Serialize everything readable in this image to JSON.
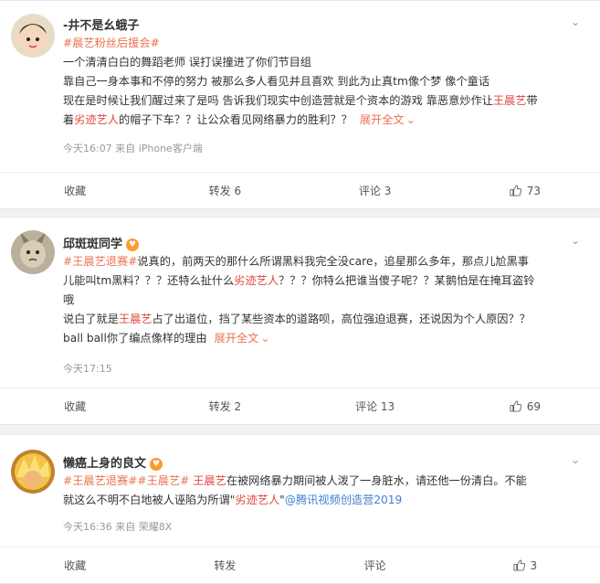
{
  "posts": [
    {
      "username": "-井不是幺蛾子",
      "hashtags": [
        "#晨艺粉丝后援会#"
      ],
      "lines": [
        "一个清清白白的舞蹈老师 误打误撞进了你们节目组",
        "靠自己一身本事和不停的努力 被那么多人看见并且喜欢 到此为止真tm像个梦 像个童话"
      ],
      "line3_pre": "现在是时候让我们醒过来了是吗 告诉我们现实中创造营就是个资本的游戏 靠恶意炒作让",
      "line3_name": "王晨艺",
      "line3_post": "带",
      "line4_pre": "着",
      "line4_label": "劣迹艺人",
      "line4_post": "的帽子下车？？让公众看见网络暴力的胜利？？",
      "expand": "展开全文",
      "meta": "今天16:07 来自 iPhone客户端",
      "actions": {
        "collect": "收藏",
        "repost": "转发 6",
        "comment": "评论 3",
        "like": "73"
      }
    },
    {
      "username": "邱斑斑同学",
      "tag1": "#王晨艺退赛#",
      "lines_a": "说真的，前两天的那什么所谓黑料我完全没care，追星那么多年，那点儿尬黑事",
      "line_b_pre": "儿能叫tm黑料？？？还特么扯什么",
      "line_b_label": "劣迹艺人",
      "line_b_post": "？？？你特么把谁当傻子呢？？某鹅怕是在掩耳盗铃",
      "line_c": "哦",
      "line_d_pre": "说白了就是",
      "line_d_name": "王晨艺",
      "line_d_post": "占了出道位，挡了某些资本的道路呗，高位强迫退赛，还说因为个人原因？？",
      "line_e": "ball ball你了编点像样的理由",
      "expand": "展开全文",
      "meta": "今天17:15",
      "actions": {
        "collect": "收藏",
        "repost": "转发 2",
        "comment": "评论 13",
        "like": "69"
      }
    },
    {
      "username": "懒癌上身的良文",
      "tag1": "#王晨艺退赛#",
      "tag2": "#王晨艺#",
      "line1_name": "王晨艺",
      "line1_post": "在被网络暴力期间被人泼了一身脏水，请还他一份清白。不能",
      "line2_pre": "就这么不明不白地被人诬陷为所谓\"",
      "line2_label": "劣迹艺人",
      "line2_mid": "\"",
      "line2_link": "@腾讯视频创造营2019",
      "meta": "今天16:36 来自 荣耀8X",
      "actions": {
        "collect": "收藏",
        "repost": "转发",
        "comment": "评论",
        "like": "3"
      }
    }
  ],
  "icons": {
    "menu": "chevron-down-icon",
    "like": "thumbs-up-icon",
    "badge": "heart-badge-icon"
  },
  "colors": {
    "tag": "#eb7350",
    "name_red": "#e2453e",
    "link_blue": "#3f7fce",
    "badge": "#ff9a2e"
  }
}
